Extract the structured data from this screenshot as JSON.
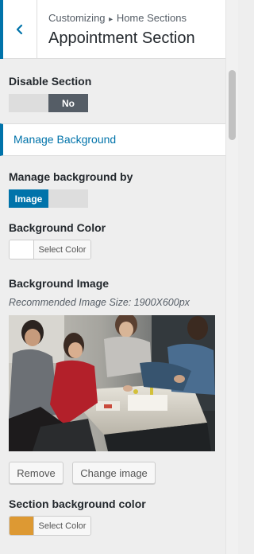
{
  "header": {
    "breadcrumb_parent": "Customizing",
    "breadcrumb_separator": "▸",
    "breadcrumb_current": "Home Sections",
    "title": "Appointment Section",
    "back_icon": "chevron-left-icon"
  },
  "disable_section": {
    "label": "Disable Section",
    "off_label": "",
    "on_label": "No",
    "selected": "No"
  },
  "manage_background_link": {
    "label": "Manage Background"
  },
  "manage_background_by": {
    "label": "Manage background by",
    "selected_label": "Image",
    "other_label": "",
    "selected": "Image"
  },
  "background_color": {
    "label": "Background Color",
    "button_label": "Select Color",
    "value": "#ffffff"
  },
  "background_image": {
    "label": "Background Image",
    "description": "Recommended Image Size: 1900X600px",
    "remove_label": "Remove",
    "change_label": "Change image"
  },
  "section_background_color": {
    "label": "Section background color",
    "button_label": "Select Color",
    "value": "#dd9933"
  },
  "colors": {
    "accent": "#0073aa",
    "toggle_dark": "#555d66",
    "panel_bg": "#eeeeee"
  }
}
